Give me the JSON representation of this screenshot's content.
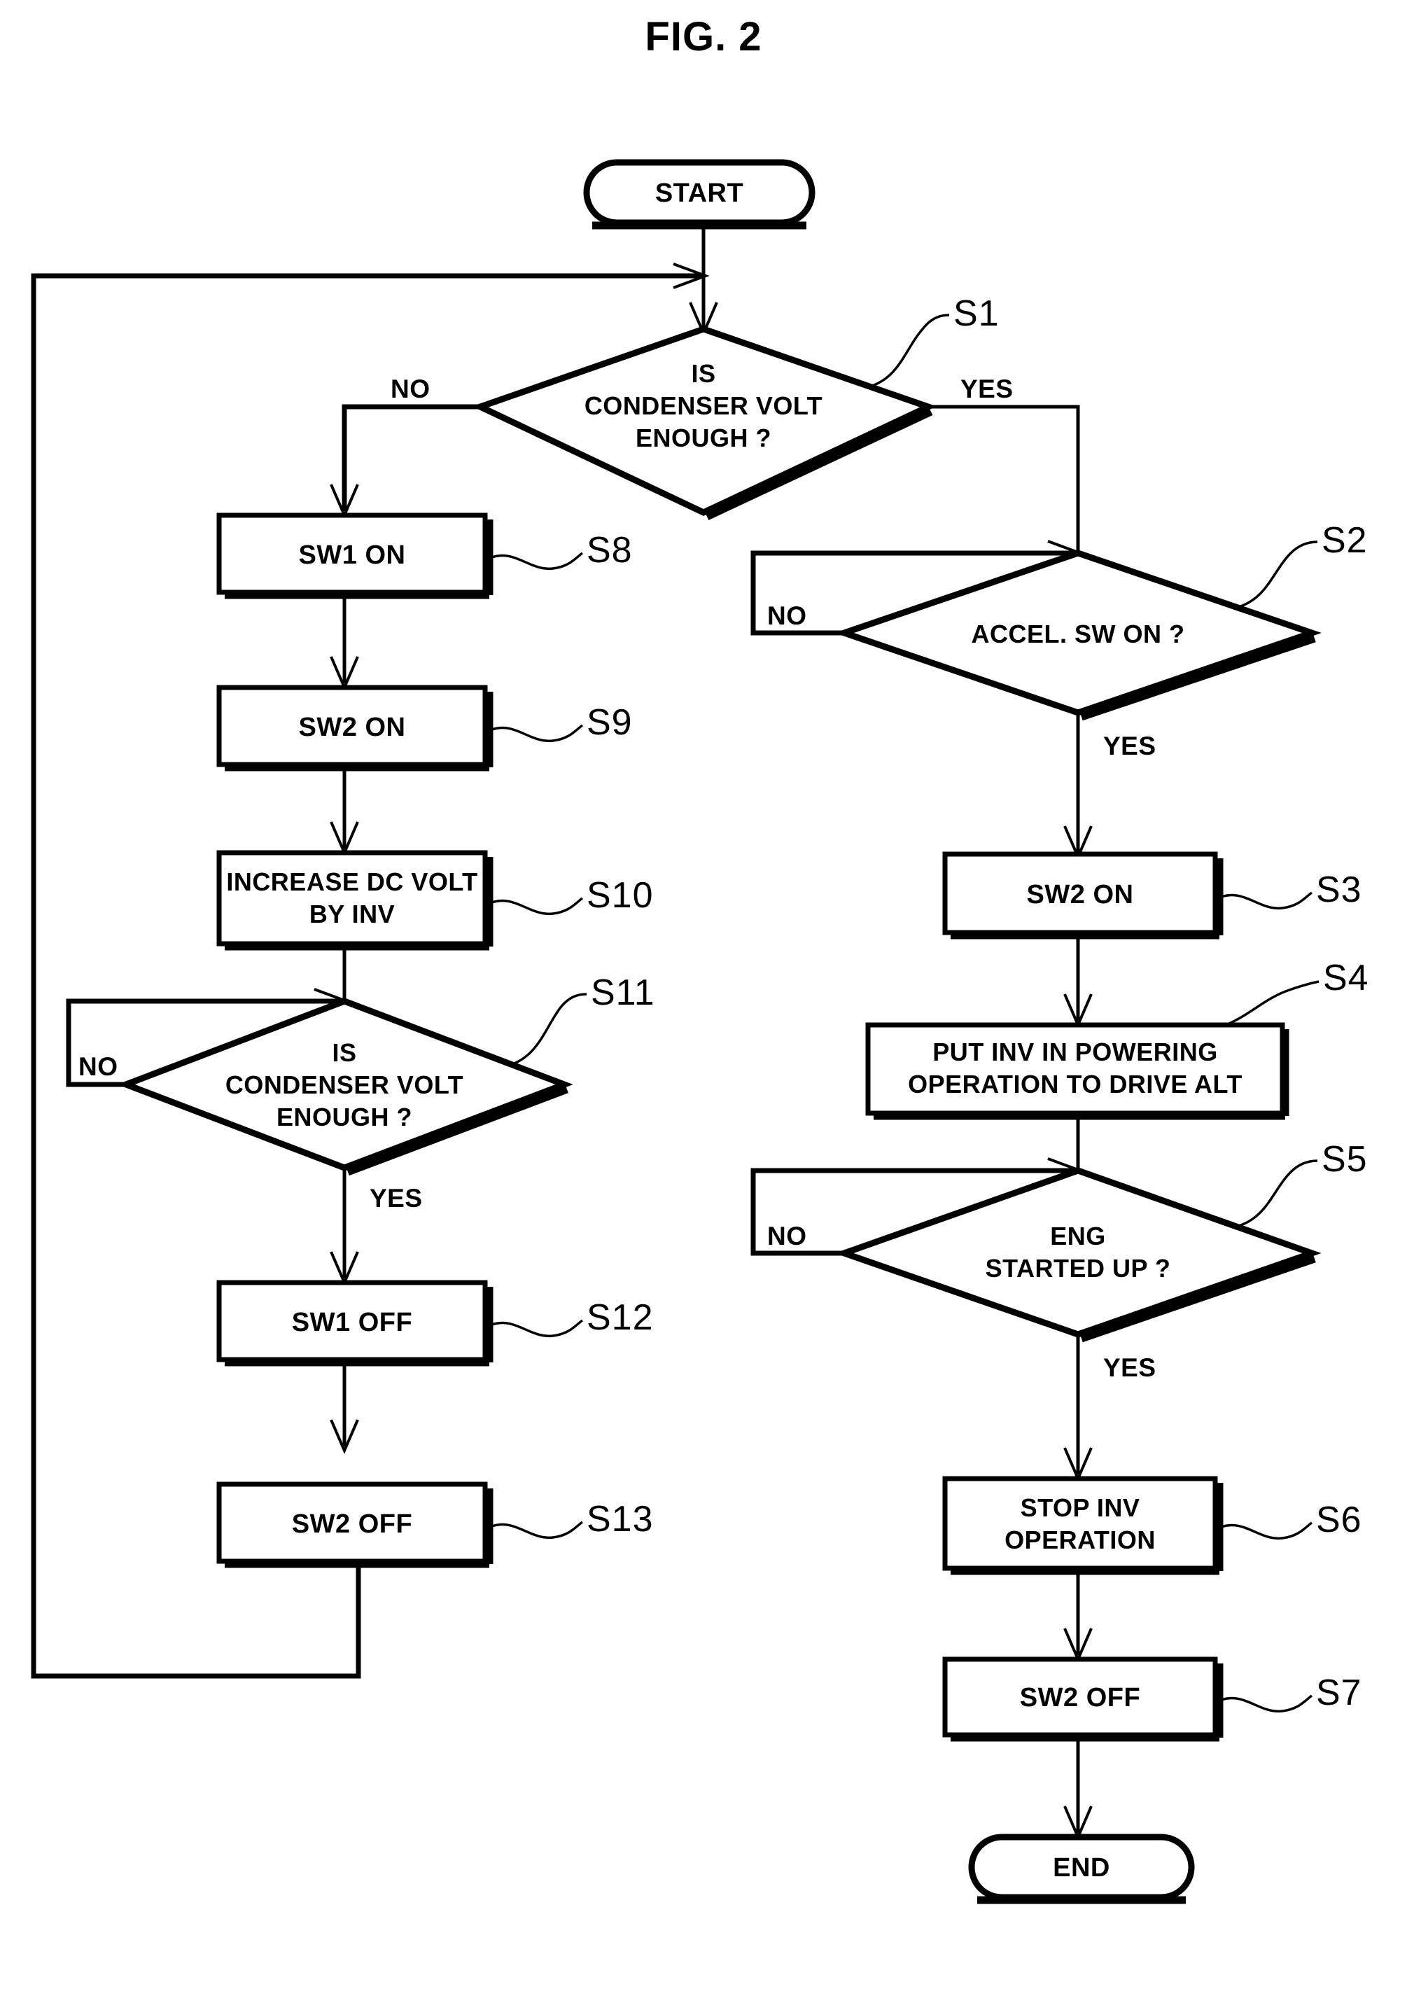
{
  "figure": {
    "title": "FIG. 2",
    "type": "flowchart"
  },
  "nodes": {
    "start": {
      "label": "START",
      "shape": "terminator"
    },
    "end": {
      "label": "END",
      "shape": "terminator"
    },
    "s1": {
      "ref": "S1",
      "line1": "IS",
      "line2": "CONDENSER VOLT",
      "line3": "ENOUGH ?",
      "shape": "decision"
    },
    "s2": {
      "ref": "S2",
      "line1": "ACCEL. SW ON ?",
      "shape": "decision"
    },
    "s3": {
      "ref": "S3",
      "line1": "SW2 ON",
      "shape": "process"
    },
    "s4": {
      "ref": "S4",
      "line1": "PUT INV IN POWERING",
      "line2": "OPERATION TO DRIVE ALT",
      "shape": "process"
    },
    "s5": {
      "ref": "S5",
      "line1": "ENG",
      "line2": "STARTED UP ?",
      "shape": "decision"
    },
    "s6": {
      "ref": "S6",
      "line1": "STOP INV",
      "line2": "OPERATION",
      "shape": "process"
    },
    "s7": {
      "ref": "S7",
      "line1": "SW2 OFF",
      "shape": "process"
    },
    "s8": {
      "ref": "S8",
      "line1": "SW1 ON",
      "shape": "process"
    },
    "s9": {
      "ref": "S9",
      "line1": "SW2 ON",
      "shape": "process"
    },
    "s10": {
      "ref": "S10",
      "line1": "INCREASE DC VOLT",
      "line2": "BY INV",
      "shape": "process"
    },
    "s11": {
      "ref": "S11",
      "line1": "IS",
      "line2": "CONDENSER VOLT",
      "line3": "ENOUGH ?",
      "shape": "decision"
    },
    "s12": {
      "ref": "S12",
      "line1": "SW1 OFF",
      "shape": "process"
    },
    "s13": {
      "ref": "S13",
      "line1": "SW2 OFF",
      "shape": "process"
    }
  },
  "branch_labels": {
    "s1_no": "NO",
    "s1_yes": "YES",
    "s2_no": "NO",
    "s2_yes": "YES",
    "s5_no": "NO",
    "s5_yes": "YES",
    "s11_no": "NO",
    "s11_yes": "YES"
  },
  "colors": {
    "ink": "#000000",
    "paper": "#ffffff"
  },
  "chart_data": {
    "type": "diagram",
    "title": "FIG. 2",
    "steps": [
      {
        "id": "START",
        "text": "START",
        "kind": "terminator"
      },
      {
        "id": "S1",
        "text": "IS CONDENSER VOLT ENOUGH ?",
        "kind": "decision",
        "yes": "S2",
        "no": "S8"
      },
      {
        "id": "S2",
        "text": "ACCEL. SW ON ?",
        "kind": "decision",
        "yes": "S3",
        "no": "S2"
      },
      {
        "id": "S3",
        "text": "SW2 ON",
        "kind": "process",
        "next": "S4"
      },
      {
        "id": "S4",
        "text": "PUT INV IN POWERING OPERATION TO DRIVE ALT",
        "kind": "process",
        "next": "S5"
      },
      {
        "id": "S5",
        "text": "ENG STARTED UP ?",
        "kind": "decision",
        "yes": "S6",
        "no": "S5"
      },
      {
        "id": "S6",
        "text": "STOP INV OPERATION",
        "kind": "process",
        "next": "S7"
      },
      {
        "id": "S7",
        "text": "SW2 OFF",
        "kind": "process",
        "next": "END"
      },
      {
        "id": "S8",
        "text": "SW1 ON",
        "kind": "process",
        "next": "S9"
      },
      {
        "id": "S9",
        "text": "SW2 ON",
        "kind": "process",
        "next": "S10"
      },
      {
        "id": "S10",
        "text": "INCREASE DC VOLT BY INV",
        "kind": "process",
        "next": "S11"
      },
      {
        "id": "S11",
        "text": "IS CONDENSER VOLT ENOUGH ?",
        "kind": "decision",
        "yes": "S12",
        "no": "S11"
      },
      {
        "id": "S12",
        "text": "SW1 OFF",
        "kind": "process",
        "next": "S13"
      },
      {
        "id": "S13",
        "text": "SW2 OFF",
        "kind": "process",
        "next": "S1"
      },
      {
        "id": "END",
        "text": "END",
        "kind": "terminator"
      }
    ]
  }
}
